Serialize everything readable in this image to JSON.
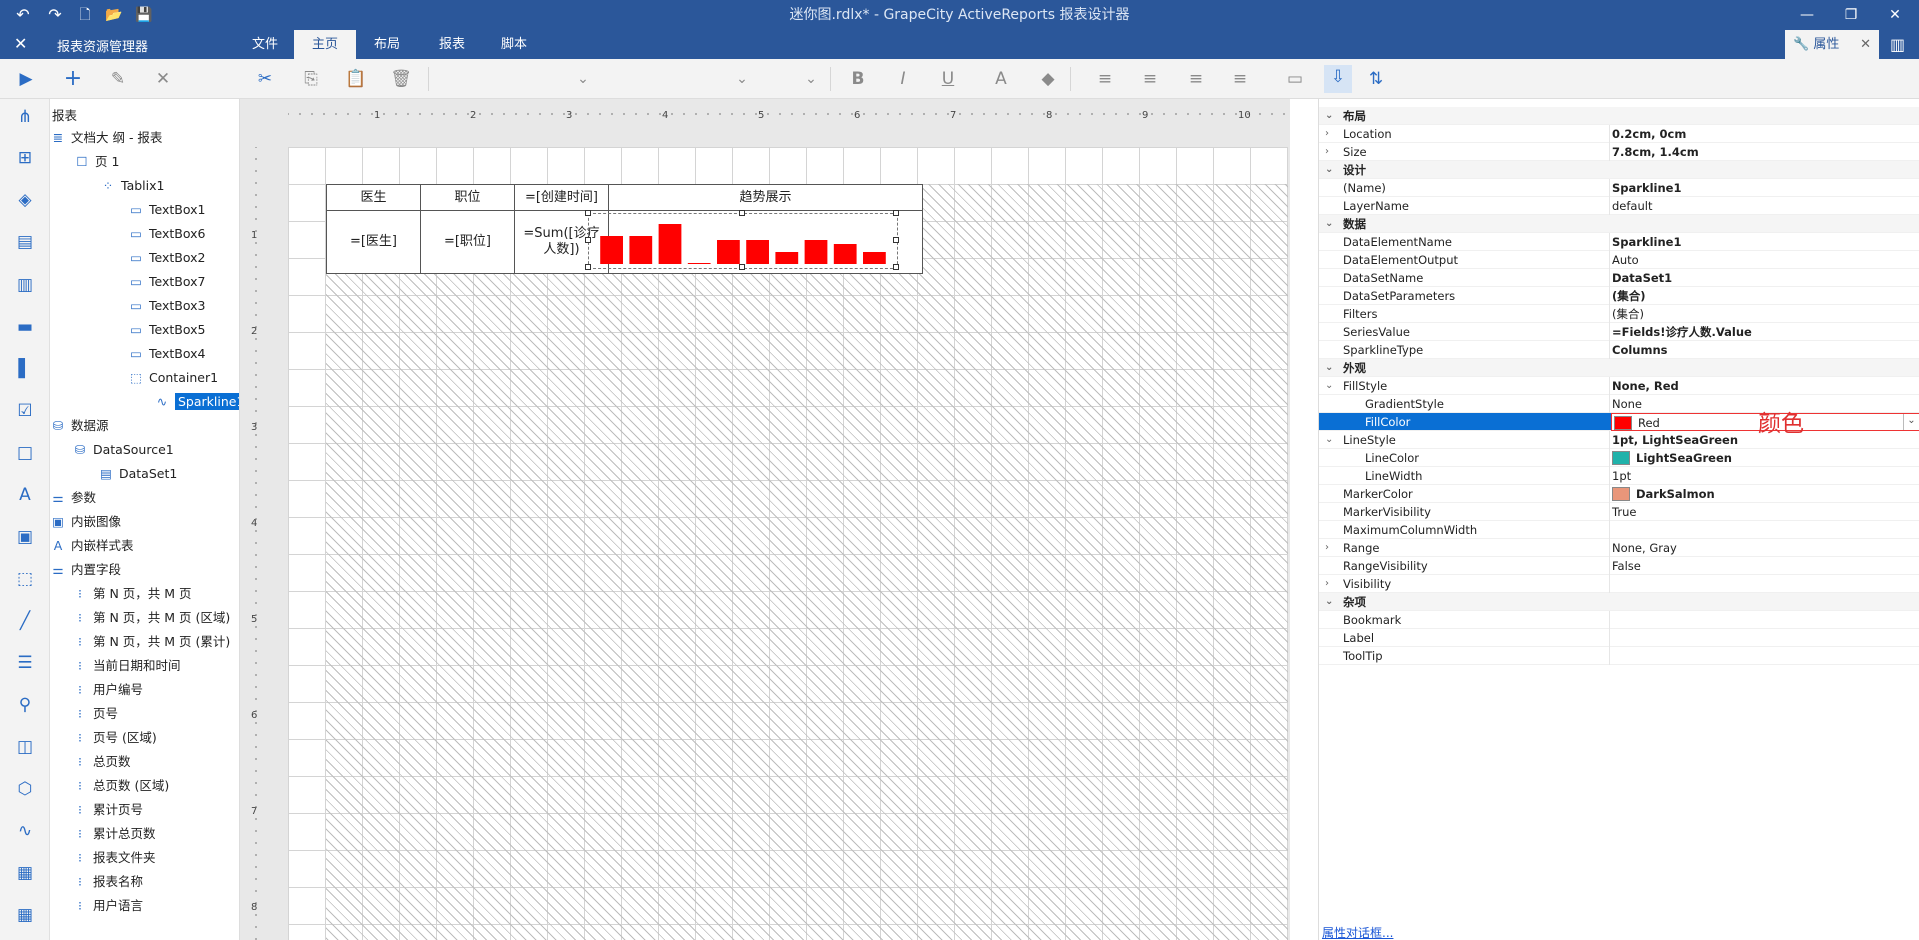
{
  "window": {
    "title": "迷你图.rdlx* - GrapeCity ActiveReports 报表设计器",
    "minimize": "—",
    "restore": "❐",
    "close": "✕"
  },
  "quickaccess": {
    "undo": "↶",
    "redo": "↷",
    "new": "🗋",
    "open": "📂",
    "save": "💾"
  },
  "ribbon": {
    "close_label": "✕",
    "explorer": "报表资源管理器",
    "tabs": [
      "文件",
      "主页",
      "布局",
      "报表",
      "脚本"
    ],
    "active_tab": "主页",
    "properties_tab": "属性",
    "properties_tab_close": "✕",
    "properties_icon": "🔧"
  },
  "toolbar": {
    "cut": "✂",
    "copy": "⎘",
    "paste": "📋",
    "delete": "🗑",
    "bold": "B",
    "italic": "I",
    "underline": "U",
    "fontcolor": "A",
    "fill": "◆",
    "align_left": "≡",
    "align_center": "≡",
    "align_right": "≡",
    "justify": "≡",
    "dropdown": "⌄"
  },
  "tree": {
    "root": "报表",
    "outline": "文档大 纲 - 报表",
    "page": "页 1",
    "tablix": "Tablix1",
    "textboxes": [
      "TextBox1",
      "TextBox6",
      "TextBox2",
      "TextBox7",
      "TextBox3",
      "TextBox5",
      "TextBox4"
    ],
    "container": "Container1",
    "sparkline": "Sparkline1",
    "datasource_root": "数据源",
    "datasource": "DataSource1",
    "dataset": "DataSet1",
    "parameters": "参数",
    "embedded_images": "内嵌图像",
    "embedded_styles": "内嵌样式表",
    "builtin_fields": "内置字段",
    "fields": [
      "第 N 页，共 M 页",
      "第 N 页，共 M 页 (区域)",
      "第 N 页，共 M 页 (累计)",
      "当前日期和时间",
      "用户编号",
      "页号",
      "页号 (区域)",
      "总页数",
      "总页数 (区域)",
      "累计页号",
      "累计总页数",
      "报表文件夹",
      "报表名称",
      "用户语言"
    ]
  },
  "ruler": {
    "h": [
      "1",
      "2",
      "3",
      "4",
      "5",
      "6",
      "7",
      "8",
      "9",
      "10"
    ],
    "v": [
      "1",
      "2",
      "3",
      "4",
      "5",
      "6",
      "7",
      "8"
    ]
  },
  "table": {
    "headers": [
      "医生",
      "职位",
      "=[创建时间]",
      "趋势展示"
    ],
    "row": [
      "=[医生]",
      "=[职位]",
      "=Sum([诊疗人数])"
    ]
  },
  "chart_data": {
    "type": "bar",
    "values": [
      7,
      7,
      10,
      0.2,
      6,
      6,
      3,
      6,
      5,
      3
    ],
    "colors": [
      "#ff0000"
    ]
  },
  "props": {
    "categories": {
      "layout": "布局",
      "design": "设计",
      "data": "数据",
      "appearance": "外观",
      "misc": "杂项"
    },
    "rows": [
      {
        "name": "Location",
        "value": "0.2cm, 0cm",
        "bold": true
      },
      {
        "name": "Size",
        "value": "7.8cm, 1.4cm",
        "bold": true
      },
      {
        "name": "(Name)",
        "value": "Sparkline1",
        "bold": true
      },
      {
        "name": "LayerName",
        "value": "default",
        "bold": false
      },
      {
        "name": "DataElementName",
        "value": "Sparkline1",
        "bold": true
      },
      {
        "name": "DataElementOutput",
        "value": "Auto",
        "bold": false
      },
      {
        "name": "DataSetName",
        "value": "DataSet1",
        "bold": true
      },
      {
        "name": "DataSetParameters",
        "value": "(集合)",
        "bold": true
      },
      {
        "name": "Filters",
        "value": "(集合)",
        "bold": false
      },
      {
        "name": "SeriesValue",
        "value": "=Fields!诊疗人数.Value",
        "bold": true
      },
      {
        "name": "SparklineType",
        "value": "Columns",
        "bold": true
      },
      {
        "name": "FillStyle",
        "value": "None, Red",
        "bold": true
      },
      {
        "name": "GradientStyle",
        "value": "None",
        "bold": false
      },
      {
        "name": "FillColor",
        "value": "Red",
        "bold": false
      },
      {
        "name": "LineStyle",
        "value": "1pt, LightSeaGreen",
        "bold": true
      },
      {
        "name": "LineColor",
        "value": "LightSeaGreen",
        "bold": true
      },
      {
        "name": "LineWidth",
        "value": "1pt",
        "bold": false
      },
      {
        "name": "MarkerColor",
        "value": "DarkSalmon",
        "bold": true
      },
      {
        "name": "MarkerVisibility",
        "value": "True",
        "bold": false
      },
      {
        "name": "MaximumColumnWidth",
        "value": "",
        "bold": false
      },
      {
        "name": "Range",
        "value": "None, Gray",
        "bold": false
      },
      {
        "name": "RangeVisibility",
        "value": "False",
        "bold": false
      },
      {
        "name": "Visibility",
        "value": "",
        "bold": false
      },
      {
        "name": "Bookmark",
        "value": "",
        "bold": false
      },
      {
        "name": "Label",
        "value": "",
        "bold": false
      },
      {
        "name": "ToolTip",
        "value": "",
        "bold": false
      }
    ],
    "colors": {
      "fill": "#ff0000",
      "line": "#20b2aa",
      "marker": "#e9967a"
    },
    "annotation": "颜色",
    "dialog_link": "属性对话框..."
  }
}
